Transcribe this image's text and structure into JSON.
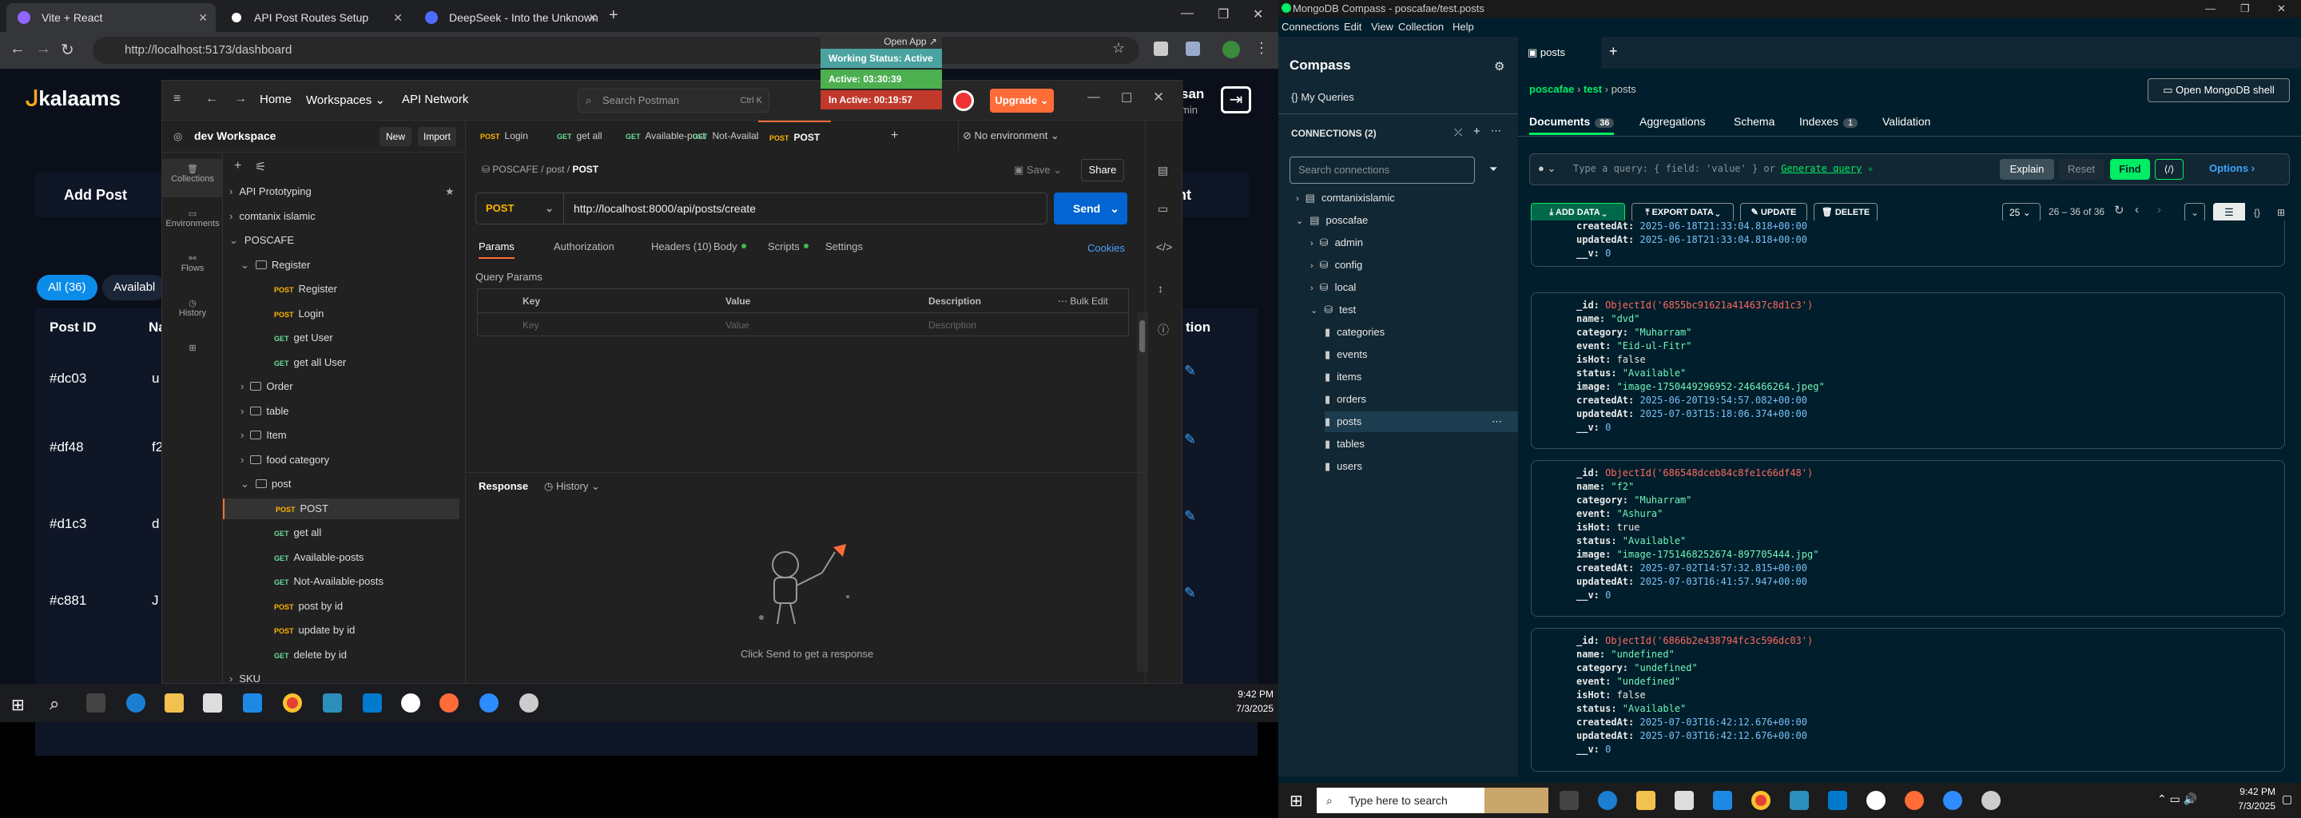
{
  "chrome": {
    "tabs": [
      {
        "label": "Vite + React"
      },
      {
        "label": "API Post Routes Setup"
      },
      {
        "label": "DeepSeek - Into the Unknown"
      }
    ],
    "url": "http://localhost:5173/dashboard"
  },
  "app": {
    "logo": "kalaams",
    "add_post": "Add Post",
    "all_pill": "All (36)",
    "avail_pill": "Availabl",
    "col_post_id": "Post ID",
    "col_n": "Na",
    "col_action": "tion",
    "col_ment": "ment",
    "user_frag": "san",
    "user_frag2": "min",
    "rows": [
      {
        "id": "#dc03",
        "c": "u"
      },
      {
        "id": "#df48",
        "c": "f2"
      },
      {
        "id": "#d1c3",
        "c": "d"
      },
      {
        "id": "#c881",
        "c": "J"
      }
    ]
  },
  "postman": {
    "nav": {
      "home": "Home",
      "workspaces": "Workspaces",
      "api_network": "API Network",
      "search": "Search Postman",
      "shortcut": "Ctrl  K",
      "upgrade": "Upgrade"
    },
    "workspace": "dev Workspace",
    "new": "New",
    "import": "Import",
    "sidenav": [
      "Collections",
      "Environments",
      "Flows",
      "History"
    ],
    "tree": [
      {
        "t": "API Prototyping",
        "lvl": 0,
        "type": "col"
      },
      {
        "t": "comtanix islamic",
        "lvl": 0,
        "type": "col"
      },
      {
        "t": "POSCAFE",
        "lvl": 0,
        "type": "col"
      },
      {
        "t": "Register",
        "lvl": 1,
        "type": "folder"
      },
      {
        "t": "Register",
        "lvl": 2,
        "m": "POST"
      },
      {
        "t": "Login",
        "lvl": 2,
        "m": "POST"
      },
      {
        "t": "get User",
        "lvl": 2,
        "m": "GET"
      },
      {
        "t": "get all User",
        "lvl": 2,
        "m": "GET"
      },
      {
        "t": "Order",
        "lvl": 1,
        "type": "folder"
      },
      {
        "t": "table",
        "lvl": 1,
        "type": "folder"
      },
      {
        "t": "Item",
        "lvl": 1,
        "type": "folder"
      },
      {
        "t": "food category",
        "lvl": 1,
        "type": "folder"
      },
      {
        "t": "post",
        "lvl": 1,
        "type": "folder"
      },
      {
        "t": "POST",
        "lvl": 2,
        "m": "POST"
      },
      {
        "t": "get all",
        "lvl": 2,
        "m": "GET"
      },
      {
        "t": "Available-posts",
        "lvl": 2,
        "m": "GET"
      },
      {
        "t": "Not-Available-posts",
        "lvl": 2,
        "m": "GET"
      },
      {
        "t": "post by id",
        "lvl": 2,
        "m": "POST"
      },
      {
        "t": "update by id",
        "lvl": 2,
        "m": "POST"
      },
      {
        "t": "delete by id",
        "lvl": 2,
        "m": "GET"
      },
      {
        "t": "SKU",
        "lvl": 0,
        "type": "col"
      }
    ],
    "tabs": [
      {
        "m": "POST",
        "t": "Login"
      },
      {
        "m": "GET",
        "t": "get all"
      },
      {
        "m": "GET",
        "t": "Available-post"
      },
      {
        "m": "GET",
        "t": "Not-Available-"
      },
      {
        "m": "POST",
        "t": "POST"
      }
    ],
    "env": "No environment",
    "breadcrumb": "POSCAFE  /  post  /",
    "breadcrumb_cur": "POST",
    "save": "Save",
    "share": "Share",
    "method": "POST",
    "req_url": "http://localhost:8000/api/posts/create",
    "send": "Send",
    "subtabs": [
      "Params",
      "Authorization",
      "Headers (10)",
      "Body",
      "Scripts",
      "Settings"
    ],
    "cookies": "Cookies",
    "query_params": "Query Params",
    "cols": {
      "key": "Key",
      "value": "Value",
      "desc": "Description",
      "bulk": "Bulk Edit"
    },
    "ph": {
      "key": "Key",
      "value": "Value",
      "desc": "Description"
    },
    "response": "Response",
    "history": "History",
    "click_send": "Click Send to get a response",
    "open_app": "Open App ↗",
    "status": {
      "working": "Working Status: Active",
      "active": "Active: 03:30:39",
      "inactive": "In Active: 00:19:57"
    }
  },
  "taskbar_left": {
    "time": "9:42 PM",
    "date": "7/3/2025"
  },
  "compass": {
    "title": "MongoDB Compass - poscafae/test.posts",
    "menu": [
      "Connections",
      "Edit",
      "View",
      "Collection",
      "Help"
    ],
    "app_name": "Compass",
    "my_queries": "My Queries",
    "connections": "CONNECTIONS (2)",
    "search_ph": "Search connections",
    "tree": [
      {
        "t": "comtanixislamic",
        "lvl": 0
      },
      {
        "t": "poscafae",
        "lvl": 0
      },
      {
        "t": "admin",
        "lvl": 1
      },
      {
        "t": "config",
        "lvl": 1
      },
      {
        "t": "local",
        "lvl": 1
      },
      {
        "t": "test",
        "lvl": 1
      },
      {
        "t": "categories",
        "lvl": 2
      },
      {
        "t": "events",
        "lvl": 2
      },
      {
        "t": "items",
        "lvl": 2
      },
      {
        "t": "orders",
        "lvl": 2
      },
      {
        "t": "posts",
        "lvl": 2
      },
      {
        "t": "tables",
        "lvl": 2
      },
      {
        "t": "users",
        "lvl": 2
      }
    ],
    "tab": "posts",
    "crumb": {
      "a": "poscafae",
      "b": "test",
      "c": "posts"
    },
    "shell": "Open MongoDB shell",
    "subtabs": {
      "docs": "Documents",
      "docs_count": "36",
      "agg": "Aggregations",
      "schema": "Schema",
      "indexes": "Indexes",
      "idx_count": "1",
      "validation": "Validation"
    },
    "query_ph": "Type a query: { field: 'value' } or",
    "gen_query": "Generate query",
    "explain": "Explain",
    "reset": "Reset",
    "find": "Find",
    "options": "Options",
    "add_data": "ADD DATA",
    "export": "EXPORT DATA",
    "update": "UPDATE",
    "delete": "DELETE",
    "page_size": "25",
    "range": "26 – 36 of 36",
    "docs": [
      {
        "lines": [
          [
            "createdAt: ",
            "2025-06-18T21:33:04.818+00:00",
            "n"
          ],
          [
            "updatedAt: ",
            "2025-06-18T21:33:04.818+00:00",
            "n"
          ],
          [
            "__v: ",
            "0",
            "n"
          ]
        ]
      },
      {
        "lines": [
          [
            "_id: ",
            "ObjectId('6855bc91621a414637c8d1c3')",
            "o"
          ],
          [
            "name: ",
            "\"dvd\"",
            "s"
          ],
          [
            "category: ",
            "\"Muharram\"",
            "s"
          ],
          [
            "event: ",
            "\"Eid-ul-Fitr\"",
            "s"
          ],
          [
            "isHot: ",
            "false",
            "b"
          ],
          [
            "status: ",
            "\"Available\"",
            "s"
          ],
          [
            "image: ",
            "\"image-1750449296952-246466264.jpeg\"",
            "s"
          ],
          [
            "createdAt: ",
            "2025-06-20T19:54:57.082+00:00",
            "n"
          ],
          [
            "updatedAt: ",
            "2025-07-03T15:18:06.374+00:00",
            "n"
          ],
          [
            "__v: ",
            "0",
            "n"
          ]
        ]
      },
      {
        "lines": [
          [
            "_id: ",
            "ObjectId('686548dceb84c8fe1c66df48')",
            "o"
          ],
          [
            "name: ",
            "\"f2\"",
            "s"
          ],
          [
            "category: ",
            "\"Muharram\"",
            "s"
          ],
          [
            "event: ",
            "\"Ashura\"",
            "s"
          ],
          [
            "isHot: ",
            "true",
            "b"
          ],
          [
            "status: ",
            "\"Available\"",
            "s"
          ],
          [
            "image: ",
            "\"image-1751468252674-897705444.jpg\"",
            "s"
          ],
          [
            "createdAt: ",
            "2025-07-02T14:57:32.815+00:00",
            "n"
          ],
          [
            "updatedAt: ",
            "2025-07-03T16:41:57.947+00:00",
            "n"
          ],
          [
            "__v: ",
            "0",
            "n"
          ]
        ]
      },
      {
        "lines": [
          [
            "_id: ",
            "ObjectId('6866b2e438794fc3c596dc03')",
            "o"
          ],
          [
            "name: ",
            "\"undefined\"",
            "s"
          ],
          [
            "category: ",
            "\"undefined\"",
            "s"
          ],
          [
            "event: ",
            "\"undefined\"",
            "s"
          ],
          [
            "isHot: ",
            "false",
            "b"
          ],
          [
            "status: ",
            "\"Available\"",
            "s"
          ],
          [
            "createdAt: ",
            "2025-07-03T16:42:12.676+00:00",
            "n"
          ],
          [
            "updatedAt: ",
            "2025-07-03T16:42:12.676+00:00",
            "n"
          ],
          [
            "__v: ",
            "0",
            "n"
          ]
        ]
      }
    ]
  },
  "taskbar_right": {
    "search": "Type here to search",
    "time": "9:42 PM",
    "date": "7/3/2025"
  }
}
